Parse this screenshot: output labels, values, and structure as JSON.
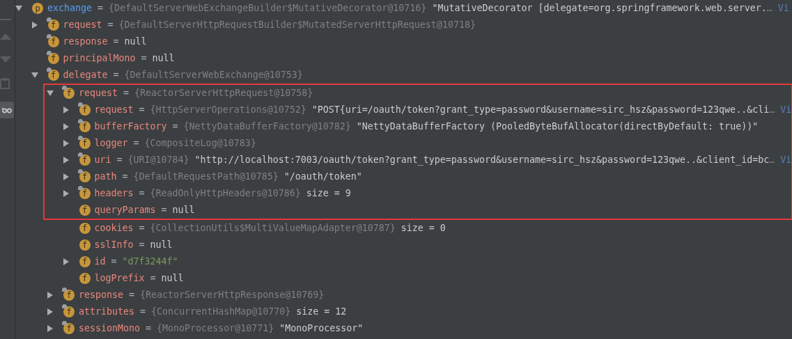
{
  "variables": [
    {
      "badge": "p",
      "final": false,
      "expanded": true,
      "name": "exchange",
      "kind": "root",
      "operator": "=",
      "type": "{DefaultServerWebExchangeBuilder$MutativeDecorator@10716}",
      "value": "\"MutativeDecorator [delegate=org.springframework.web.server.",
      "string_value": false,
      "ellipsis": "…",
      "link": "Vi",
      "highlighted": false,
      "children": [
        {
          "badge": "f",
          "final": true,
          "expanded": false,
          "name": "request",
          "kind": "field",
          "operator": "=",
          "type": "{DefaultServerHttpRequestBuilder$MutatedServerHttpRequest@10718}",
          "highlighted": false
        },
        {
          "badge": "f",
          "final": true,
          "name": "response",
          "kind": "field",
          "operator": "=",
          "value": "null",
          "string_value": false,
          "highlighted": false
        },
        {
          "badge": "f",
          "final": true,
          "name": "principalMono",
          "kind": "field",
          "operator": "=",
          "value": "null",
          "string_value": false,
          "highlighted": false
        },
        {
          "badge": "f",
          "final": true,
          "expanded": true,
          "name": "delegate",
          "kind": "field",
          "operator": "=",
          "type": "{DefaultServerWebExchange@10753}",
          "highlighted": false,
          "children": [
            {
              "badge": "f",
              "final": true,
              "expanded": true,
              "name": "request",
              "kind": "field",
              "operator": "=",
              "type": "{ReactorServerHttpRequest@10758}",
              "highlighted": true,
              "children": [
                {
                  "badge": "f",
                  "final": true,
                  "expanded": false,
                  "name": "request",
                  "kind": "field",
                  "operator": "=",
                  "type": "{HttpServerOperations@10752}",
                  "value": "\"POST{uri=/oauth/token?grant_type=password&username=sirc_hsz&password=123qwe..&cli",
                  "string_value": false,
                  "ellipsis": "…",
                  "link": "Vi",
                  "highlighted": true
                },
                {
                  "badge": "f",
                  "final": true,
                  "expanded": false,
                  "name": "bufferFactory",
                  "kind": "field",
                  "operator": "=",
                  "type": "{NettyDataBufferFactory@10782}",
                  "value": "\"NettyDataBufferFactory (PooledByteBufAllocator(directByDefault: true))\"",
                  "string_value": false,
                  "highlighted": true
                },
                {
                  "badge": "f",
                  "final": true,
                  "expanded": false,
                  "name": "logger",
                  "kind": "field",
                  "operator": "=",
                  "type": "{CompositeLog@10783}",
                  "highlighted": true
                },
                {
                  "badge": "f",
                  "final": true,
                  "expanded": false,
                  "name": "uri",
                  "kind": "field",
                  "operator": "=",
                  "type": "{URI@10784}",
                  "value": "\"http://localhost:7003/oauth/token?grant_type=password&username=sirc_hsz&password=123qwe..&client_id=bc",
                  "string_value": false,
                  "ellipsis": "…",
                  "link": "Vi",
                  "highlighted": true
                },
                {
                  "badge": "f",
                  "final": true,
                  "expanded": false,
                  "name": "path",
                  "kind": "field",
                  "operator": "=",
                  "type": "{DefaultRequestPath@10785}",
                  "value": "\"/oauth/token\"",
                  "string_value": false,
                  "highlighted": true
                },
                {
                  "badge": "f",
                  "final": true,
                  "expanded": false,
                  "name": "headers",
                  "kind": "field",
                  "operator": "=",
                  "type": "{ReadOnlyHttpHeaders@10786}",
                  "value": "size = 9",
                  "string_value": false,
                  "highlighted": true
                },
                {
                  "badge": "f",
                  "final": false,
                  "name": "queryParams",
                  "kind": "field",
                  "operator": "=",
                  "value": "null",
                  "string_value": false,
                  "highlighted": true
                },
                {
                  "badge": "f",
                  "final": false,
                  "name": "cookies",
                  "kind": "field",
                  "operator": "=",
                  "type": "{CollectionUtils$MultiValueMapAdapter@10787}",
                  "value": "size = 0",
                  "string_value": false,
                  "highlighted": false
                },
                {
                  "badge": "f",
                  "final": false,
                  "name": "sslInfo",
                  "kind": "field",
                  "operator": "=",
                  "value": "null",
                  "string_value": false,
                  "highlighted": false
                },
                {
                  "badge": "f",
                  "final": false,
                  "expanded": false,
                  "name": "id",
                  "kind": "field",
                  "operator": "=",
                  "value": "\"d7f3244f\"",
                  "string_value": true,
                  "highlighted": false
                },
                {
                  "badge": "f",
                  "final": false,
                  "name": "logPrefix",
                  "kind": "field",
                  "operator": "=",
                  "value": "null",
                  "string_value": false,
                  "highlighted": false
                }
              ]
            },
            {
              "badge": "f",
              "final": true,
              "expanded": false,
              "name": "response",
              "kind": "field",
              "operator": "=",
              "type": "{ReactorServerHttpResponse@10769}",
              "highlighted": false
            },
            {
              "badge": "f",
              "final": true,
              "expanded": false,
              "name": "attributes",
              "kind": "field",
              "operator": "=",
              "type": "{ConcurrentHashMap@10770}",
              "value": "size = 12",
              "string_value": false,
              "highlighted": false
            },
            {
              "badge": "f",
              "final": true,
              "expanded": false,
              "name": "sessionMono",
              "kind": "field",
              "operator": "=",
              "type": "{MonoProcessor@10771}",
              "value": "\"MonoProcessor\"",
              "string_value": false,
              "highlighted": false
            }
          ]
        }
      ]
    }
  ]
}
